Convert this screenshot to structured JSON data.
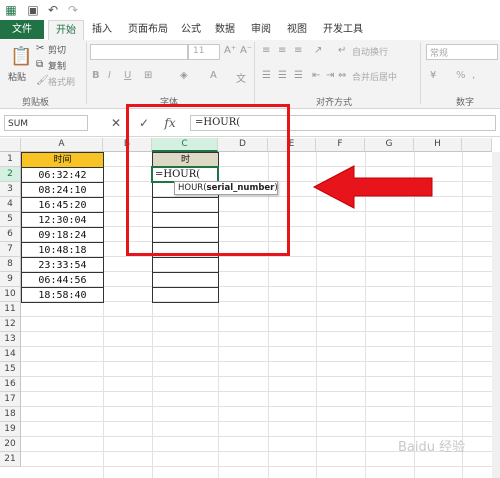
{
  "ribbon_tabs": [
    "文件",
    "开始",
    "插入",
    "页面布局",
    "公式",
    "数据",
    "审阅",
    "视图",
    "开发工具"
  ],
  "clipboard": {
    "cut": "剪切",
    "copy": "复制",
    "format_painter": "格式刷",
    "paste": "粘贴",
    "group_label": "剪贴板"
  },
  "font": {
    "size": "11",
    "group_label": "字体",
    "bold": "B",
    "italic": "I",
    "underline": "U"
  },
  "alignment": {
    "wrap": "自动换行",
    "merge": "合并后居中",
    "group_label": "对齐方式"
  },
  "number": {
    "format": "常规",
    "percent": "%",
    "comma": ",",
    "group_label": "数字"
  },
  "formula_bar": {
    "name_box": "SUM",
    "cancel": "✕",
    "enter": "✓",
    "fx": "fx",
    "content": "=HOUR("
  },
  "columns": [
    "A",
    "B",
    "C",
    "D",
    "E",
    "F",
    "G",
    "H"
  ],
  "rows": [
    "1",
    "2",
    "3",
    "4",
    "5",
    "6",
    "7",
    "8",
    "9",
    "10",
    "11",
    "12",
    "13",
    "14",
    "15",
    "16",
    "17",
    "18",
    "19",
    "20",
    "21"
  ],
  "sheet": {
    "a1": "时间",
    "times": [
      "06:32:42",
      "08:24:10",
      "16:45:20",
      "12:30:04",
      "09:18:24",
      "10:48:18",
      "23:33:54",
      "06:44:56",
      "18:58:40"
    ],
    "c1": "时",
    "c2": "=HOUR(",
    "tooltip_func": "HOUR(",
    "tooltip_arg": "serial_number",
    "tooltip_end": ")"
  },
  "watermark": "Baidu 经验",
  "colors": {
    "accent": "#217346",
    "header_fill_a": "#f7c325",
    "header_fill_c": "#ddd9c4",
    "highlight_red": "#e8141c"
  }
}
